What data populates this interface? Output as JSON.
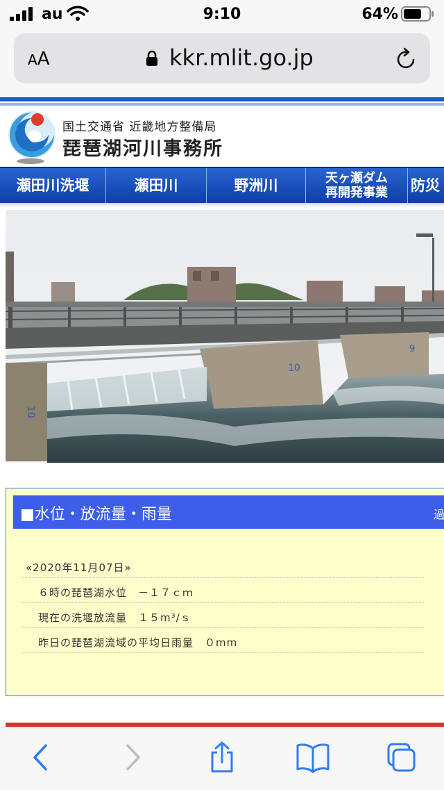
{
  "status_bar": {
    "carrier": "au",
    "time": "9:10",
    "battery_percent": "64%"
  },
  "browser": {
    "text_size_label_small": "A",
    "text_size_label_large": "A",
    "url": "kkr.mlit.go.jp"
  },
  "site": {
    "org_line1": "国土交通省 近畿地方整備局",
    "org_line2": "琵琶湖河川事務所"
  },
  "nav": [
    {
      "label": "瀬田川洗堰"
    },
    {
      "label": "瀬田川"
    },
    {
      "label": "野洲川"
    },
    {
      "label_line1": "天ヶ瀬ダム",
      "label_line2": "再開発事業"
    },
    {
      "label": "防災・"
    }
  ],
  "water_info": {
    "title": "■水位・放流量・雨量",
    "more_link": "過去",
    "date": "«2020年11月07日»",
    "rows": [
      "６時の琵琶湖水位　－１７ｃｍ",
      "現在の洗堰放流量　１５m³/ｓ",
      "昨日の琵琶湖流域の平均日雨量　０mm"
    ]
  },
  "colors": {
    "nav_blue": "#1c4fbf",
    "panel_head": "#3c5ee8",
    "panel_bg": "#ffffcc",
    "accent_red": "#d8352a",
    "ios_blue": "#2f7cf6"
  }
}
